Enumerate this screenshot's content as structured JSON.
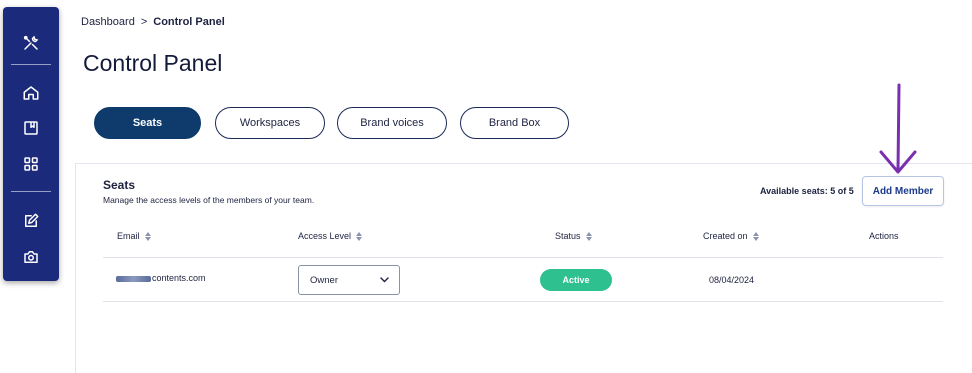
{
  "colors": {
    "sidebar_bg": "#1b2a7a",
    "active_tab_bg": "#0e3b6b",
    "status_active": "#2fc08f",
    "annotation_arrow": "#7a2fb0",
    "add_button_text": "#1b3a8a"
  },
  "sidebar": {
    "items": [
      {
        "icon": "tools-icon"
      },
      {
        "icon": "home-icon"
      },
      {
        "icon": "book-icon"
      },
      {
        "icon": "grid-icon"
      },
      {
        "icon": "edit-icon"
      },
      {
        "icon": "camera-icon"
      }
    ]
  },
  "breadcrumb": {
    "parent": "Dashboard",
    "separator": ">",
    "current": "Control Panel"
  },
  "page_title": "Control Panel",
  "tabs": [
    {
      "label": "Seats",
      "active": true
    },
    {
      "label": "Workspaces",
      "active": false
    },
    {
      "label": "Brand voices",
      "active": false
    },
    {
      "label": "Brand Box",
      "active": false
    }
  ],
  "seats": {
    "title": "Seats",
    "subtitle": "Manage the access levels of the members of your team.",
    "available": "Available seats: 5 of 5",
    "add_button": "Add Member"
  },
  "table": {
    "headers": [
      "Email",
      "Access Level",
      "Status",
      "Created on",
      "Actions"
    ],
    "rows": [
      {
        "email": "contents.com",
        "access_level": "Owner",
        "status": "Active",
        "created_on": "08/04/2024"
      }
    ]
  }
}
